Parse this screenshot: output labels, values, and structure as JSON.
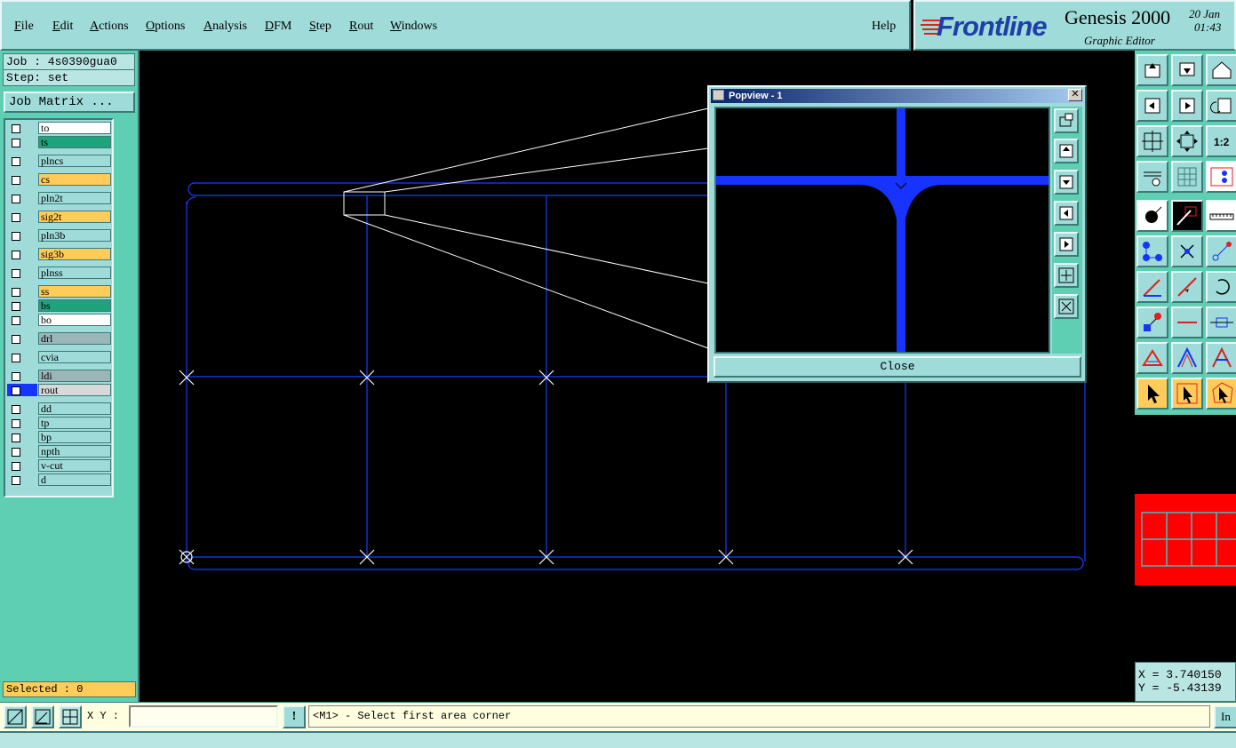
{
  "menu": {
    "items": [
      {
        "label": "File",
        "key": "F"
      },
      {
        "label": "Edit",
        "key": "E"
      },
      {
        "label": "Actions",
        "key": "A"
      },
      {
        "label": "Options",
        "key": "O"
      },
      {
        "label": "Analysis",
        "key": "A"
      },
      {
        "label": "DFM",
        "key": "D"
      },
      {
        "label": "Step",
        "key": "S"
      },
      {
        "label": "Rout",
        "key": "R"
      },
      {
        "label": "Windows",
        "key": "W"
      }
    ],
    "help": "Help"
  },
  "brand": {
    "logo": "Frontline",
    "title": "Genesis 2000",
    "subtitle": "Graphic Editor",
    "date": "20 Jan",
    "time": "01:43",
    "logo_color": "#1f3fa8",
    "stripe_color": "#e0201c"
  },
  "job": {
    "job_line": "Job : 4s0390gua0",
    "step_line": "Step: set",
    "matrix_button": "Job Matrix ..."
  },
  "layers": [
    {
      "name": "to",
      "color": "#ffffff"
    },
    {
      "name": "ts",
      "color": "#1fa37a"
    },
    {
      "name": "plncs",
      "color": "#9fdbd9"
    },
    {
      "name": "cs",
      "color": "#ffcc5a"
    },
    {
      "name": "pln2t",
      "color": "#9fdbd9"
    },
    {
      "name": "sig2t",
      "color": "#ffcc5a"
    },
    {
      "name": "pln3b",
      "color": "#9fdbd9"
    },
    {
      "name": "sig3b",
      "color": "#ffcc5a"
    },
    {
      "name": "plnss",
      "color": "#9fdbd9"
    },
    {
      "name": "ss",
      "color": "#ffcc5a"
    },
    {
      "name": "bs",
      "color": "#1fa37a"
    },
    {
      "name": "bo",
      "color": "#ffffff"
    },
    {
      "name": "drl",
      "color": "#9bb6b8"
    },
    {
      "name": "cvia",
      "color": "#9fdbd9"
    },
    {
      "name": "ldi",
      "color": "#9bb6b8"
    },
    {
      "name": "rout",
      "color": "#d8d8d8",
      "active": true
    },
    {
      "name": "dd",
      "color": "#9fdbd9"
    },
    {
      "name": "tp",
      "color": "#9fdbd9"
    },
    {
      "name": "bp",
      "color": "#9fdbd9"
    },
    {
      "name": "npth",
      "color": "#9fdbd9"
    },
    {
      "name": "v-cut",
      "color": "#9fdbd9"
    },
    {
      "name": "d",
      "color": "#9fdbd9"
    }
  ],
  "selected": "Selected : 0",
  "popview": {
    "title": "Popview - 1",
    "close_label": "Close",
    "close_x": "✕",
    "trace_color": "#1633ff"
  },
  "rout_color": "#1a3cff",
  "coords": {
    "x": "X = 3.740150",
    "y": "Y = -5.43139"
  },
  "bottom": {
    "xy_label": "X Y :",
    "xy_value": "",
    "warn": "!",
    "message": "<M1> - Select first area corner",
    "in_button": "In"
  }
}
